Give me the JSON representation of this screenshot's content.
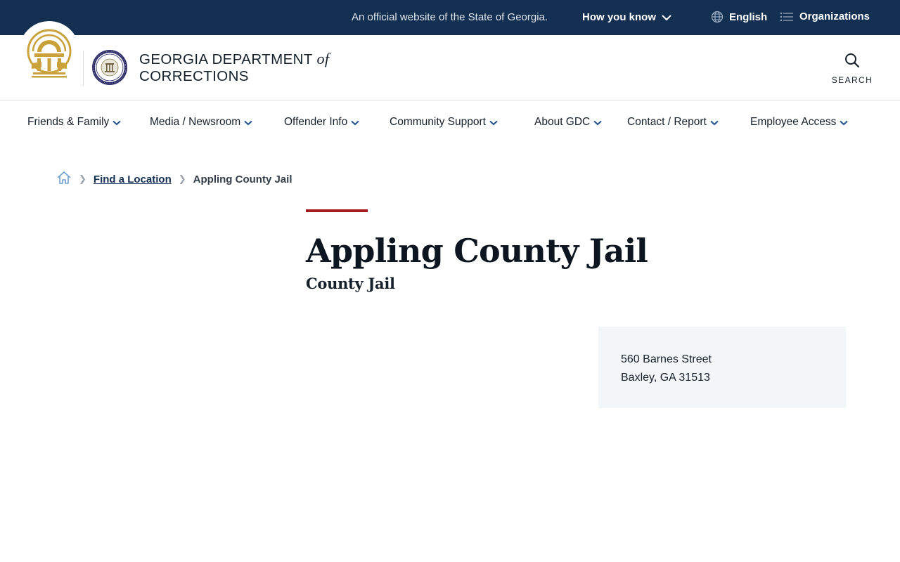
{
  "banner": {
    "official_text": "An official website of the State of Georgia.",
    "how_you_know": "How you know",
    "language": "English",
    "organizations": "Organizations"
  },
  "header": {
    "title_line1": "GEORGIA DEPARTMENT",
    "title_of": "of",
    "title_line2": "CORRECTIONS",
    "search_label": "SEARCH"
  },
  "nav": {
    "items": [
      {
        "label": "Friends & Family"
      },
      {
        "label": "Media / Newsroom"
      },
      {
        "label": "Offender Info"
      },
      {
        "label": "Community Support"
      },
      {
        "label": "About GDC"
      },
      {
        "label": "Contact / Report"
      },
      {
        "label": "Employee Access"
      }
    ]
  },
  "breadcrumb": {
    "home_icon": "home-icon",
    "link": "Find a Location",
    "current": "Appling County Jail"
  },
  "page": {
    "title": "Appling County Jail",
    "subtitle": "County Jail"
  },
  "address": {
    "street": "560 Barnes Street",
    "city_state_zip": "Baxley, GA 31513"
  },
  "colors": {
    "banner_bg": "#132f52",
    "accent_red": "#a7191f",
    "seal_gold": "#c9a23c",
    "address_bg": "#f3f6f9"
  }
}
